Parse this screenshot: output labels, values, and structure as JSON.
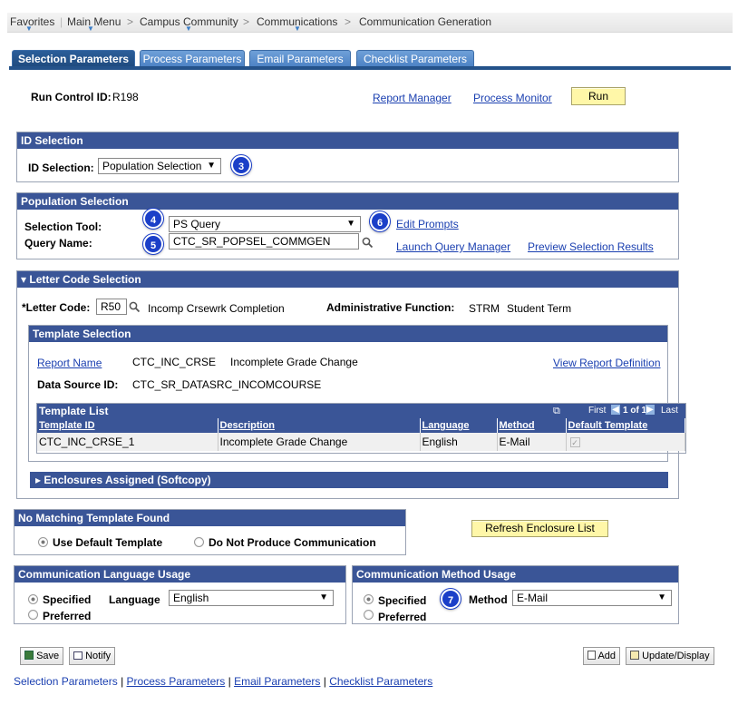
{
  "nav": {
    "favorites": "Favorites",
    "main_menu": "Main Menu",
    "campus_community": "Campus Community",
    "communications": "Communications",
    "communication_generation": "Communication Generation",
    "sep": ">"
  },
  "tabs": [
    {
      "label": "Selection Parameters",
      "active": true
    },
    {
      "label": "Process Parameters",
      "active": false
    },
    {
      "label": "Email Parameters",
      "active": false
    },
    {
      "label": "Checklist Parameters",
      "active": false
    }
  ],
  "run_control": {
    "label": "Run Control ID:",
    "value": "R198",
    "report_manager": "Report Manager",
    "process_monitor": "Process Monitor",
    "run_button": "Run"
  },
  "id_selection": {
    "title": "ID Selection",
    "label": "ID Selection:",
    "value": "Population Selection"
  },
  "population_selection": {
    "title": "Population Selection",
    "tool_label": "Selection Tool:",
    "tool_value": "PS Query",
    "query_label": "Query Name:",
    "query_value": "CTC_SR_POPSEL_COMMGEN",
    "edit_prompts": "Edit Prompts",
    "launch_query_manager": "Launch Query Manager",
    "preview_selection_results": "Preview Selection Results"
  },
  "letter_code": {
    "title": "Letter Code Selection",
    "label": "*Letter Code:",
    "value": "R50",
    "description": "Incomp Crsewrk Completion",
    "admin_function_label": "Administrative Function:",
    "admin_function_code": "STRM",
    "admin_function_desc": "Student Term"
  },
  "template_selection": {
    "title": "Template Selection",
    "report_name_label": "Report Name",
    "report_name_value": "CTC_INC_CRSE",
    "report_name_desc": "Incomplete Grade Change",
    "view_report_definition": "View Report Definition",
    "data_source_label": "Data Source ID:",
    "data_source_value": "CTC_SR_DATASRC_INCOMCOURSE"
  },
  "template_list": {
    "title": "Template List",
    "nav_first": "First",
    "nav_count": "1 of 1",
    "nav_last": "Last",
    "columns": [
      "Template ID",
      "Description",
      "Language",
      "Method",
      "Default Template"
    ],
    "rows": [
      {
        "template_id": "CTC_INC_CRSE_1",
        "description": "Incomplete Grade Change",
        "language": "English",
        "method": "E-Mail",
        "default": true
      }
    ]
  },
  "enclosures": {
    "title": "Enclosures Assigned (Softcopy)"
  },
  "no_match": {
    "title": "No Matching Template Found",
    "option_default": "Use Default Template",
    "option_none": "Do Not Produce Communication",
    "refresh_button": "Refresh Enclosure List"
  },
  "language_usage": {
    "title": "Communication Language Usage",
    "specified": "Specified",
    "preferred": "Preferred",
    "language_label": "Language",
    "language_value": "English"
  },
  "method_usage": {
    "title": "Communication Method Usage",
    "specified": "Specified",
    "preferred": "Preferred",
    "method_label": "Method",
    "method_value": "E-Mail"
  },
  "badges": [
    "3",
    "4",
    "5",
    "6",
    "7"
  ],
  "toolbar": {
    "save": "Save",
    "notify": "Notify",
    "add": "Add",
    "update_display": "Update/Display"
  },
  "footer_links": {
    "selection": "Selection Parameters",
    "process": "Process Parameters",
    "email": "Email Parameters",
    "checklist": "Checklist Parameters",
    "sep": "|"
  },
  "colors": {
    "group_header": "#3a5597",
    "tab_active": "#24528a",
    "tab_inactive": "#5a8fcf",
    "badge": "#1b3fc8",
    "yellow_button": "#fff7a8",
    "link": "#1a3fb0"
  }
}
